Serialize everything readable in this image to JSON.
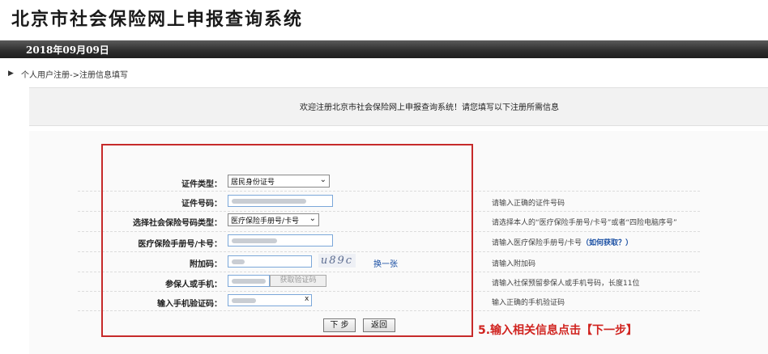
{
  "header": {
    "system_title": "北京市社会保险网上申报查询系统",
    "date": "2018年09月09日"
  },
  "breadcrumb": "个人用户注册->注册信息填写",
  "welcome": "欢迎注册北京市社会保险网上申报查询系统！请您填写以下注册所需信息",
  "form": {
    "id_type": {
      "label": "证件类型：",
      "value": "居民身份证号"
    },
    "id_number": {
      "label": "证件号码：",
      "hint": "请输入正确的证件号码"
    },
    "insurance_type": {
      "label": "选择社会保险号码类型：",
      "value": "医疗保险手册号/卡号",
      "hint": "请选择本人的“医疗保险手册号/卡号”或者“四险电脑序号”"
    },
    "insurance_number": {
      "label": "医疗保险手册号/卡号：",
      "hint": "请输入医疗保险手册号/卡号",
      "hint_link": "（如何获取？）"
    },
    "captcha": {
      "label": "附加码：",
      "image_text": "u89c",
      "change_link": "换一张",
      "hint": "请输入附加码"
    },
    "phone": {
      "label": "参保人或手机：",
      "get_code_button": "获取验证码",
      "hint": "请输入社保预留参保人或手机号码，长度11位"
    },
    "sms_code": {
      "label": "输入手机验证码：",
      "clear_icon": "x",
      "hint": "输入正确的手机验证码"
    },
    "next_button": "下 步",
    "back_button": "返回"
  },
  "annotation": "5.输入相关信息点击【下一步】",
  "colors": {
    "annotation_red": "#c62a2a",
    "link_blue": "#1a4fa3"
  }
}
